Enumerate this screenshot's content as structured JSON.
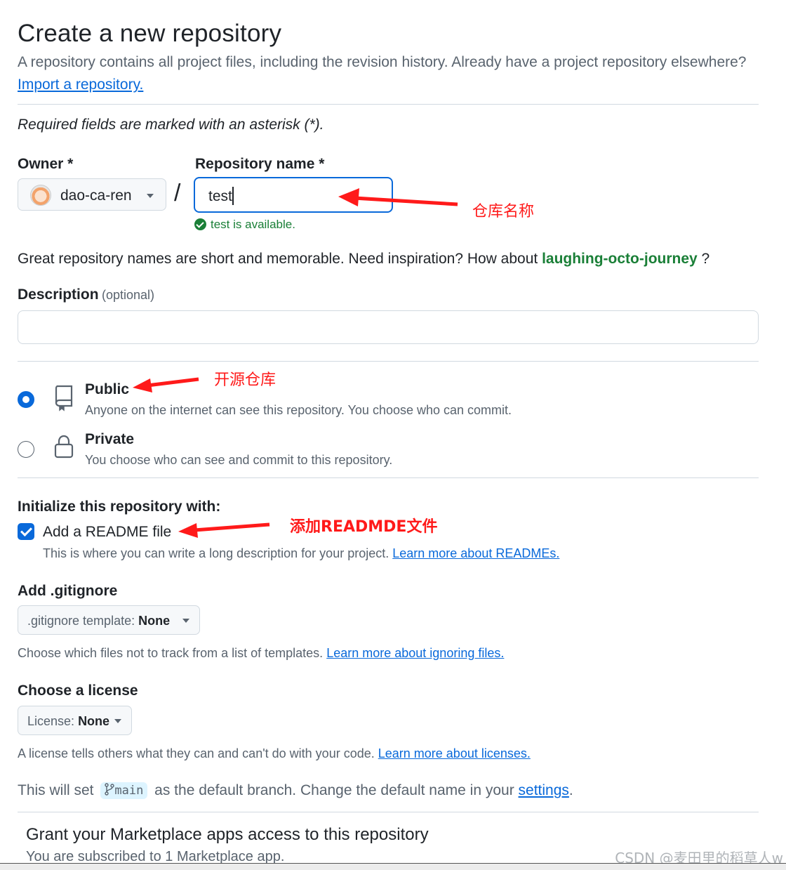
{
  "header": {
    "title": "Create a new repository",
    "subtitle": "A repository contains all project files, including the revision history. Already have a project repository elsewhere?",
    "import_link": "Import a repository."
  },
  "required_note": "Required fields are marked with an asterisk (*).",
  "owner": {
    "label": "Owner *",
    "value": "dao-ca-ren"
  },
  "separator": "/",
  "repo_name": {
    "label": "Repository name *",
    "value": "test",
    "availability": "test is available."
  },
  "inspiration": {
    "text": "Great repository names are short and memorable. Need inspiration? How about",
    "suggestion": "laughing-octo-journey",
    "suffix": " ?"
  },
  "description": {
    "label": "Description",
    "optional": "(optional)",
    "value": ""
  },
  "visibility": {
    "selected": "Public",
    "options": [
      {
        "title": "Public",
        "desc": "Anyone on the internet can see this repository. You choose who can commit.",
        "icon": "repo-icon"
      },
      {
        "title": "Private",
        "desc": "You choose who can see and commit to this repository.",
        "icon": "lock-icon"
      }
    ]
  },
  "initialize": {
    "heading": "Initialize this repository with:",
    "readme_label": "Add a README file",
    "readme_checked": true,
    "readme_desc": "This is where you can write a long description for your project.",
    "readme_link": "Learn more about READMEs."
  },
  "gitignore": {
    "heading": "Add .gitignore",
    "select_prefix": ".gitignore template:",
    "select_value": "None",
    "desc": "Choose which files not to track from a list of templates.",
    "link": "Learn more about ignoring files."
  },
  "license": {
    "heading": "Choose a license",
    "select_prefix": "License:",
    "select_value": "None",
    "desc": "A license tells others what they can and can't do with your code.",
    "link": "Learn more about licenses."
  },
  "branch": {
    "prefix": "This will set",
    "name": "main",
    "middle": "as the default branch. Change the default name in your",
    "link": "settings",
    "suffix": "."
  },
  "marketplace": {
    "title": "Grant your Marketplace apps access to this repository",
    "subtitle": "You are subscribed to 1 Marketplace app."
  },
  "annotations": {
    "repo_name": "仓库名称",
    "public": "开源仓库",
    "readme": "添加READMDE文件"
  },
  "watermark": "CSDN @麦田里的稻草人w",
  "colors": {
    "accent": "#0969da",
    "success": "#1a7f37",
    "annotation": "#ff1a1a",
    "muted": "#59636e"
  }
}
